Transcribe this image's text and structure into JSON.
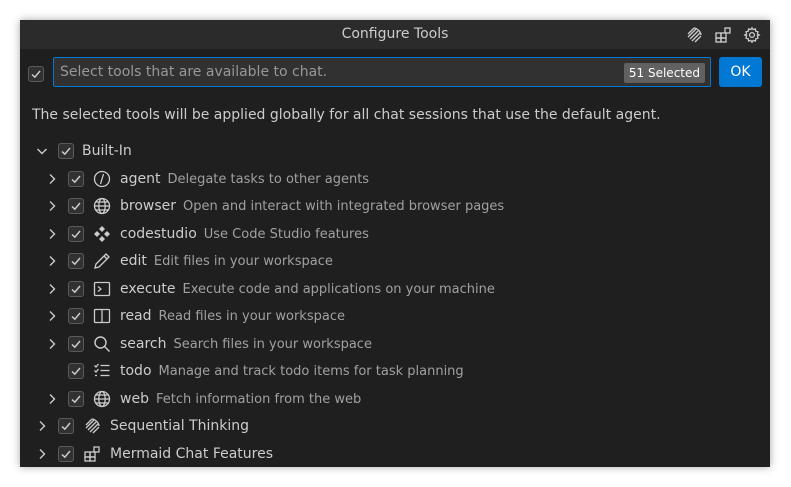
{
  "dialog": {
    "title": "Configure Tools",
    "filter": {
      "placeholder": "Select tools that are available to chat.",
      "value": ""
    },
    "selected_count": "51 Selected",
    "ok_label": "OK",
    "description": "The selected tools will be applied globally for all chat sessions that use the default agent."
  },
  "groups": {
    "builtin": {
      "label": "Built-In"
    },
    "sequential": {
      "label": "Sequential Thinking"
    },
    "mermaid": {
      "label": "Mermaid Chat Features"
    }
  },
  "tools": [
    {
      "name": "agent",
      "desc": "Delegate tasks to other agents",
      "icon": "agent-icon"
    },
    {
      "name": "browser",
      "desc": "Open and interact with integrated browser pages",
      "icon": "globe-icon"
    },
    {
      "name": "codestudio",
      "desc": "Use Code Studio features",
      "icon": "codestudio-icon"
    },
    {
      "name": "edit",
      "desc": "Edit files in your workspace",
      "icon": "pencil-icon"
    },
    {
      "name": "execute",
      "desc": "Execute code and applications on your machine",
      "icon": "terminal-icon"
    },
    {
      "name": "read",
      "desc": "Read files in your workspace",
      "icon": "book-icon"
    },
    {
      "name": "search",
      "desc": "Search files in your workspace",
      "icon": "search-icon"
    },
    {
      "name": "todo",
      "desc": "Manage and track todo items for task planning",
      "icon": "checklist-icon"
    },
    {
      "name": "web",
      "desc": "Fetch information from the web",
      "icon": "globe-icon"
    }
  ]
}
